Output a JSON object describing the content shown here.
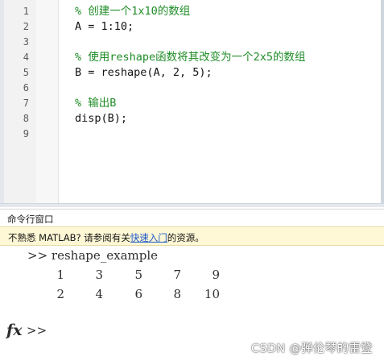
{
  "editor": {
    "lines": [
      {
        "num": "1",
        "text": "% 创建一个1x10的数组",
        "kind": "comment"
      },
      {
        "num": "2",
        "text": "A = 1:10;",
        "kind": "code"
      },
      {
        "num": "3",
        "text": "",
        "kind": "code"
      },
      {
        "num": "4",
        "text": "% 使用reshape函数将其改变为一个2x5的数组",
        "kind": "comment"
      },
      {
        "num": "5",
        "text": "B = reshape(A, 2, 5);",
        "kind": "code"
      },
      {
        "num": "6",
        "text": "",
        "kind": "code"
      },
      {
        "num": "7",
        "text": "% 输出B",
        "kind": "comment"
      },
      {
        "num": "8",
        "text": "disp(B);",
        "kind": "code"
      },
      {
        "num": "9",
        "text": "",
        "kind": "code"
      }
    ]
  },
  "command_window": {
    "title": "命令行窗口",
    "info_bar": {
      "prefix": "不熟悉 MATLAB? 请参阅有关",
      "link": "快速入门",
      "suffix": "的资源。"
    },
    "history_prompt": ">>",
    "history_command": "reshape_example",
    "output_rows": [
      [
        "1",
        "3",
        "5",
        "7",
        "9"
      ],
      [
        "2",
        "4",
        "6",
        "8",
        "10"
      ]
    ],
    "fx_label": "fx",
    "prompt": ">>"
  },
  "watermark": "CSDN @弹伦琴的雷登"
}
